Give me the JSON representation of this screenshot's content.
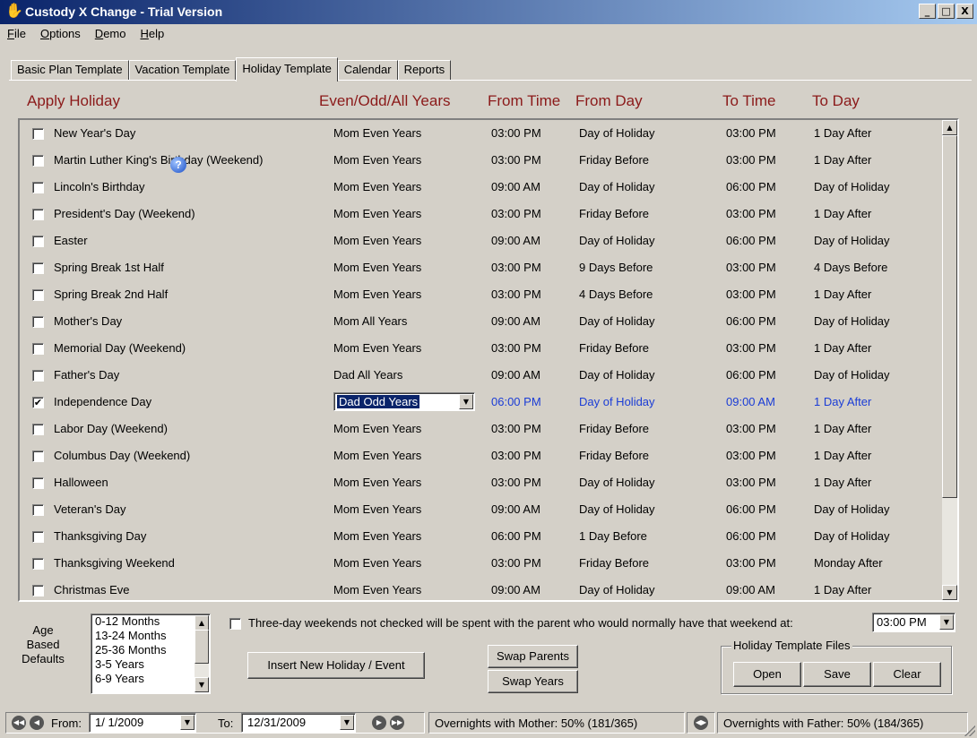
{
  "window": {
    "title": "Custody X Change - Trial Version",
    "buttons": {
      "minimize": "_",
      "maximize": "□",
      "close": "X"
    }
  },
  "menu": [
    {
      "label_u": "F",
      "label_rest": "ile"
    },
    {
      "label_u": "O",
      "label_rest": "ptions"
    },
    {
      "label_u": "D",
      "label_rest": "emo"
    },
    {
      "label_u": "H",
      "label_rest": "elp"
    }
  ],
  "tabs": [
    {
      "label": "Basic Plan Template",
      "active": false
    },
    {
      "label": "Vacation Template",
      "active": false
    },
    {
      "label": "Holiday Template",
      "active": true
    },
    {
      "label": "Calendar",
      "active": false
    },
    {
      "label": "Reports",
      "active": false
    }
  ],
  "columns": {
    "apply_holiday": "Apply Holiday",
    "years": "Even/Odd/All Years",
    "from_time": "From Time",
    "from_day": "From Day",
    "to_time": "To Time",
    "to_day": "To Day"
  },
  "holidays": [
    {
      "name": "New Year's Day",
      "years": "Mom Even Years",
      "from_time": "03:00 PM",
      "from_day": "Day of Holiday",
      "to_time": "03:00 PM",
      "to_day": "1 Day After",
      "checked": false
    },
    {
      "name": "Martin Luther King's Birthday (Weekend)",
      "years": "Mom Even Years",
      "from_time": "03:00 PM",
      "from_day": "Friday Before",
      "to_time": "03:00 PM",
      "to_day": "1 Day After",
      "checked": false
    },
    {
      "name": "Lincoln's Birthday",
      "years": "Mom Even Years",
      "from_time": "09:00 AM",
      "from_day": "Day of Holiday",
      "to_time": "06:00 PM",
      "to_day": "Day of Holiday",
      "checked": false
    },
    {
      "name": "President's Day (Weekend)",
      "years": "Mom Even Years",
      "from_time": "03:00 PM",
      "from_day": "Friday Before",
      "to_time": "03:00 PM",
      "to_day": "1 Day After",
      "checked": false
    },
    {
      "name": "Easter",
      "years": "Mom Even Years",
      "from_time": "09:00 AM",
      "from_day": "Day of Holiday",
      "to_time": "06:00 PM",
      "to_day": "Day of Holiday",
      "checked": false
    },
    {
      "name": "Spring Break 1st Half",
      "years": "Mom Even Years",
      "from_time": "03:00 PM",
      "from_day": "9 Days Before",
      "to_time": "03:00 PM",
      "to_day": "4 Days Before",
      "checked": false
    },
    {
      "name": "Spring Break 2nd Half",
      "years": "Mom Even Years",
      "from_time": "03:00 PM",
      "from_day": "4 Days Before",
      "to_time": "03:00 PM",
      "to_day": "1 Day After",
      "checked": false
    },
    {
      "name": "Mother's Day",
      "years": "Mom All Years",
      "from_time": "09:00 AM",
      "from_day": "Day of Holiday",
      "to_time": "06:00 PM",
      "to_day": "Day of Holiday",
      "checked": false
    },
    {
      "name": "Memorial Day (Weekend)",
      "years": "Mom Even Years",
      "from_time": "03:00 PM",
      "from_day": "Friday Before",
      "to_time": "03:00 PM",
      "to_day": "1 Day After",
      "checked": false
    },
    {
      "name": "Father's Day",
      "years": "Dad All Years",
      "from_time": "09:00 AM",
      "from_day": "Day of Holiday",
      "to_time": "06:00 PM",
      "to_day": "Day of Holiday",
      "checked": false
    },
    {
      "name": "Independence Day",
      "years": "Dad Odd Years",
      "from_time": "06:00 PM",
      "from_day": "Day of Holiday",
      "to_time": "09:00 AM",
      "to_day": "1 Day After",
      "checked": true,
      "selected": true
    },
    {
      "name": "Labor Day (Weekend)",
      "years": "Mom Even Years",
      "from_time": "03:00 PM",
      "from_day": "Friday Before",
      "to_time": "03:00 PM",
      "to_day": "1 Day After",
      "checked": false
    },
    {
      "name": "Columbus Day (Weekend)",
      "years": "Mom Even Years",
      "from_time": "03:00 PM",
      "from_day": "Friday Before",
      "to_time": "03:00 PM",
      "to_day": "1 Day After",
      "checked": false
    },
    {
      "name": "Halloween",
      "years": "Mom Even Years",
      "from_time": "03:00 PM",
      "from_day": "Day of Holiday",
      "to_time": "03:00 PM",
      "to_day": "1 Day After",
      "checked": false
    },
    {
      "name": "Veteran's Day",
      "years": "Mom Even Years",
      "from_time": "09:00 AM",
      "from_day": "Day of Holiday",
      "to_time": "06:00 PM",
      "to_day": "Day of Holiday",
      "checked": false
    },
    {
      "name": "Thanksgiving Day",
      "years": "Mom Even Years",
      "from_time": "06:00 PM",
      "from_day": "1 Day Before",
      "to_time": "06:00 PM",
      "to_day": "Day of Holiday",
      "checked": false
    },
    {
      "name": "Thanksgiving Weekend",
      "years": "Mom Even Years",
      "from_time": "03:00 PM",
      "from_day": "Friday Before",
      "to_time": "03:00 PM",
      "to_day": "Monday After",
      "checked": false
    },
    {
      "name": "Christmas Eve",
      "years": "Mom Even Years",
      "from_time": "09:00 AM",
      "from_day": "Day of Holiday",
      "to_time": "09:00 AM",
      "to_day": "1 Day After",
      "checked": false
    }
  ],
  "help_icon_glyph": "?",
  "age_defaults": {
    "label_lines": [
      "Age",
      "Based",
      "Defaults"
    ],
    "options": [
      "0-12 Months",
      "13-24 Months",
      "25-36 Months",
      "3-5 Years",
      "6-9 Years"
    ]
  },
  "three_day": {
    "text": "Three-day weekends not checked will be spent with the parent who would normally have that weekend at:",
    "time": "03:00 PM"
  },
  "buttons": {
    "insert": "Insert New Holiday / Event",
    "swap_parents": "Swap Parents",
    "swap_years": "Swap Years"
  },
  "template_files": {
    "title": "Holiday Template Files",
    "open": "Open",
    "save": "Save",
    "clear": "Clear"
  },
  "status": {
    "from_label": "From:",
    "from_date": "1/ 1/2009",
    "to_label": "To:",
    "to_date": "12/31/2009",
    "mother": "Overnights with Mother: 50% (181/365)",
    "father": "Overnights with Father: 50% (184/365)"
  },
  "colors": {
    "title_gradient_start": "#0a246a",
    "header_text": "#8b1a1a",
    "selected_row_text": "#1a3cd6",
    "face": "#d4d0c8"
  }
}
